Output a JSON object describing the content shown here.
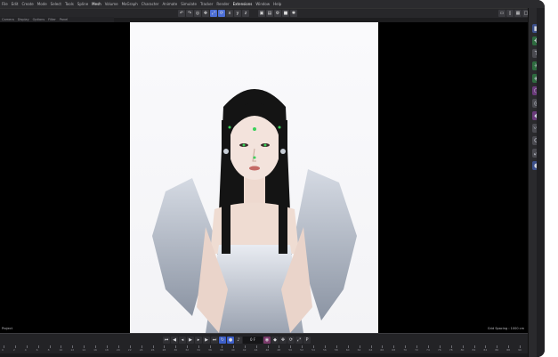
{
  "menubar": {
    "items": [
      "File",
      "Edit",
      "Create",
      "Mode",
      "Select",
      "Tools",
      "Spline",
      "Mesh",
      "Volume",
      "MoGraph",
      "Character",
      "Animate",
      "Simulate",
      "Tracker",
      "Render",
      "Extensions",
      "Window",
      "Help"
    ]
  },
  "submenu": {
    "items": [
      "Camera",
      "Display",
      "Options",
      "Filter",
      "Panel"
    ]
  },
  "viewport": {
    "left_label": "Perspective",
    "right_label": "Grid Spacing : 1000 cm",
    "project_label": "Project"
  },
  "timeline": {
    "frame_field": "0 F",
    "ruler": [
      "0",
      "2",
      "4",
      "6",
      "8",
      "10",
      "12",
      "14",
      "16",
      "18",
      "20",
      "22",
      "24",
      "26",
      "28",
      "30",
      "32",
      "34",
      "36",
      "38",
      "40",
      "42",
      "44",
      "46",
      "48",
      "50",
      "52",
      "54",
      "56",
      "58",
      "60",
      "62",
      "64",
      "66",
      "68",
      "70",
      "72",
      "74",
      "76",
      "78",
      "80",
      "82",
      "84",
      "86",
      "88",
      "90"
    ]
  },
  "icons": {
    "right_strip": [
      "cube-icon",
      "move-icon",
      "text-icon",
      "light-icon",
      "nurbs-icon",
      "deformer-icon",
      "camera-icon",
      "tag-icon",
      "spline-icon",
      "rotate-icon",
      "scale-icon",
      "globe-icon"
    ],
    "timeline": [
      "go-start-icon",
      "prev-key-icon",
      "prev-frame-icon",
      "play-icon",
      "next-frame-icon",
      "next-key-icon",
      "go-end-icon"
    ]
  },
  "colors": {
    "accent": "#4d6fd6",
    "background": "#1d1d1f"
  }
}
